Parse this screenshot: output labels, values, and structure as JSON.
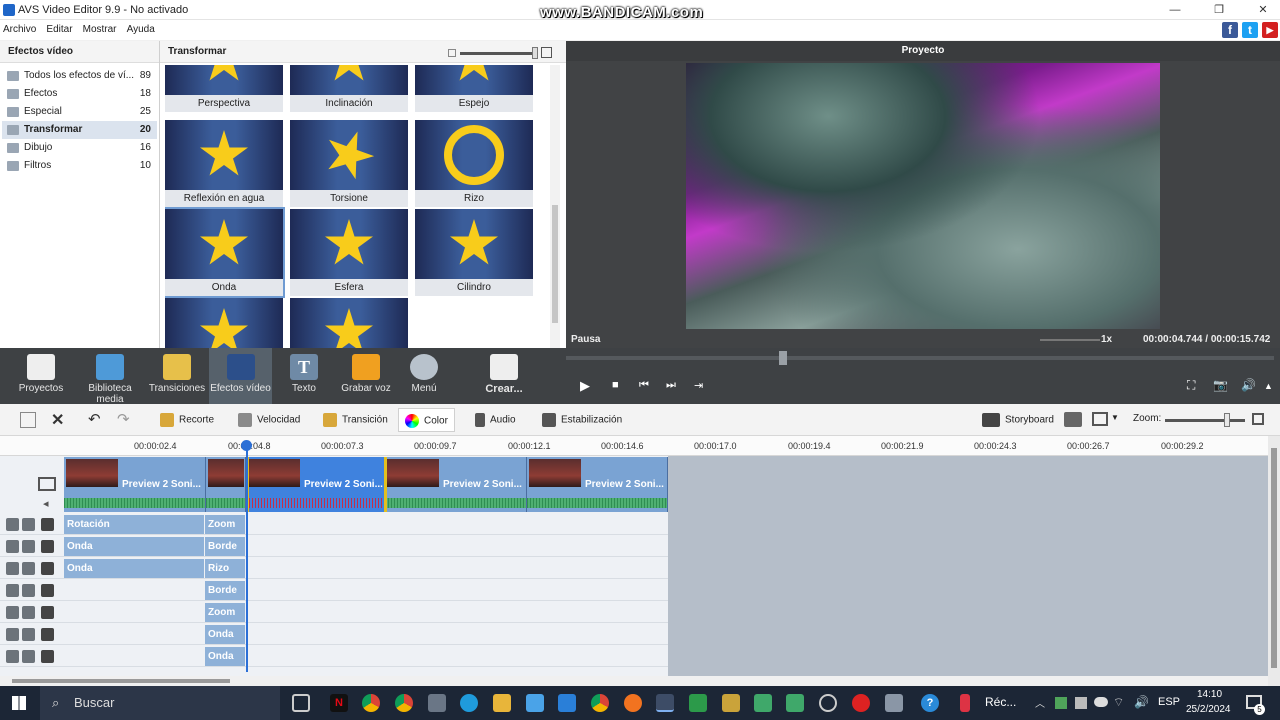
{
  "window": {
    "title": "AVS Video Editor 9.9 - No activado",
    "minimize": "—",
    "restore": "❐",
    "close": "✕"
  },
  "watermark": "www.BANDICAM.com",
  "menu": [
    "Archivo",
    "Editar",
    "Mostrar",
    "Ayuda"
  ],
  "social": {
    "facebook": "f",
    "twitter": "t",
    "youtube": "▶"
  },
  "left_panel": {
    "title": "Efectos vídeo",
    "categories": [
      {
        "label": "Todos los efectos de ví...",
        "count": "89"
      },
      {
        "label": "Efectos",
        "count": "18"
      },
      {
        "label": "Especial",
        "count": "25"
      },
      {
        "label": "Transformar",
        "count": "20"
      },
      {
        "label": "Dibujo",
        "count": "16"
      },
      {
        "label": "Filtros",
        "count": "10"
      }
    ]
  },
  "effects_panel": {
    "title": "Transformar",
    "tiles": [
      "Perspectiva",
      "Inclinación",
      "Espejo",
      "Reflexión en agua",
      "Torsione",
      "Rizo",
      "Onda",
      "Esfera",
      "Cilindro",
      "",
      ""
    ]
  },
  "preview": {
    "title": "Proyecto",
    "state": "Pausa",
    "speed": "1x",
    "time": "00:00:04.744 / 00:00:15.742"
  },
  "toolbar": [
    "Proyectos",
    "Biblioteca media",
    "Transiciones",
    "Efectos vídeo",
    "Texto",
    "Grabar voz",
    "Menú",
    "Crear..."
  ],
  "edit_tools": {
    "recorte": "Recorte",
    "velocidad": "Velocidad",
    "transicion": "Transición",
    "color": "Color",
    "audio": "Audio",
    "estabilizacion": "Estabilización",
    "storyboard": "Storyboard",
    "zoom": "Zoom:"
  },
  "ruler": [
    "00:00:02.4",
    "00:00:04.8",
    "00:00:07.3",
    "00:00:09.7",
    "00:00:12.1",
    "00:00:14.6",
    "00:00:17.0",
    "00:00:19.4",
    "00:00:21.9",
    "00:00:24.3",
    "00:00:26.7",
    "00:00:29.2"
  ],
  "clips": [
    "Preview 2 Soni...",
    "Preview 2 Soni...",
    "Preview 2 Soni...",
    "Preview 2 Soni..."
  ],
  "fx_rows": [
    {
      "a": "Rotación",
      "b": "Zoom"
    },
    {
      "a": "Onda",
      "b": "Borde"
    },
    {
      "a": "Onda",
      "b": "Rizo"
    },
    {
      "a": "",
      "b": "Borde"
    },
    {
      "a": "",
      "b": "Zoom"
    },
    {
      "a": "",
      "b": "Onda"
    },
    {
      "a": "",
      "b": "Onda"
    }
  ],
  "taskbar": {
    "search": "Buscar",
    "label_rec": "Réc...",
    "lang": "ESP",
    "time": "14:10",
    "date": "25/2/2024",
    "notif": "5"
  }
}
